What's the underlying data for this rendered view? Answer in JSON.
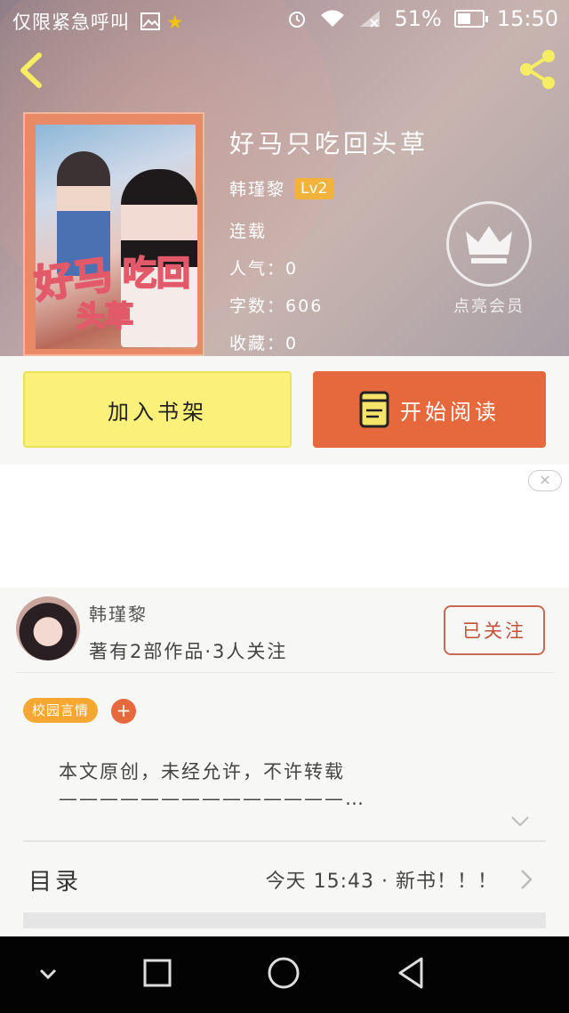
{
  "status_bar": {
    "left_text": "仅限紧急呼叫",
    "star": "★",
    "battery": "51%",
    "time": "15:50"
  },
  "book": {
    "title": "好马只吃回头草",
    "author": "韩瑾黎",
    "level": "Lv2",
    "status": "连载",
    "popularity_label": "人气：",
    "popularity": "0",
    "words_label": "字数：",
    "words": "606",
    "favorites_label": "收藏：",
    "favorites": "0",
    "cover_text": "好马只吃回头草"
  },
  "vip": {
    "label": "点亮会员"
  },
  "actions": {
    "add_shelf": "加入书架",
    "start_reading": "开始阅读"
  },
  "ad": {
    "close": "✕"
  },
  "author_bar": {
    "name": "韩瑾黎",
    "description": "著有2部作品·3人关注",
    "follow": "已关注"
  },
  "tags": {
    "items": [
      "校园言情"
    ],
    "add": "+"
  },
  "description": {
    "line1": "本文原创，未经允许，不许转载",
    "line2": "——————————————…"
  },
  "toc": {
    "label": "目录",
    "latest": "今天 15:43 · 新书！！！"
  },
  "colors": {
    "accent": "#e5693c",
    "shelf_button": "#fbf17a",
    "tag": "#f5a732",
    "level_badge": "#f3b23a"
  },
  "icons": {
    "back": "back-arrow-icon",
    "share": "share-icon",
    "crown": "crown-icon",
    "book": "book-icon",
    "nav_back": "triangle-back-icon",
    "nav_home": "circle-home-icon",
    "nav_recent": "square-recent-icon"
  }
}
